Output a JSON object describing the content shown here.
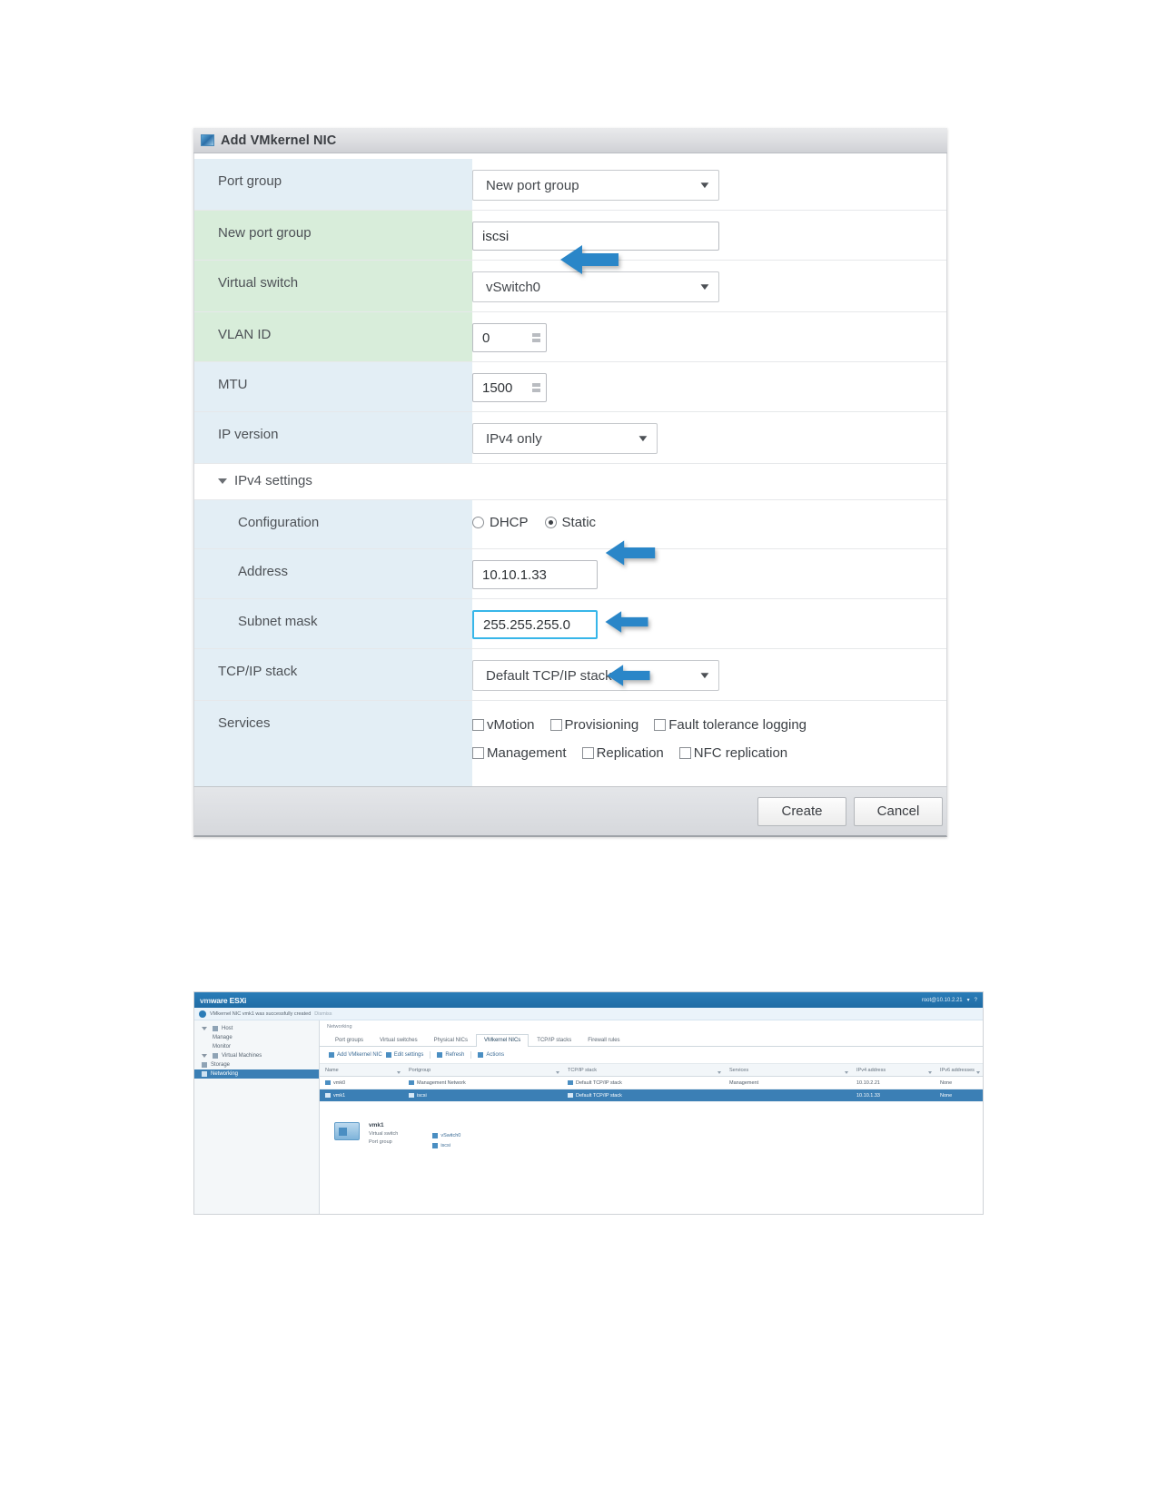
{
  "dialog": {
    "title": "Add VMkernel NIC",
    "title_icon": "vmkernel-nic-icon",
    "rows": [
      {
        "label": "Port group",
        "value": "New port group",
        "widget": "select"
      },
      {
        "label": "New port group",
        "value": "iscsi",
        "widget": "text"
      },
      {
        "label": "Virtual switch",
        "value": "vSwitch0",
        "widget": "select"
      },
      {
        "label": "VLAN ID",
        "value": "0",
        "widget": "spinner"
      },
      {
        "label": "MTU",
        "value": "1500",
        "widget": "spinner"
      },
      {
        "label": "IP version",
        "value": "IPv4 only",
        "widget": "select"
      }
    ],
    "ipv4_section_label": "IPv4 settings",
    "configuration": {
      "label": "Configuration",
      "options": [
        "DHCP",
        "Static"
      ],
      "selected": "Static"
    },
    "address": {
      "label": "Address",
      "value": "10.10.1.33"
    },
    "subnet": {
      "label": "Subnet mask",
      "value": "255.255.255.0"
    },
    "tcpip": {
      "label": "TCP/IP stack",
      "value": "Default TCP/IP stack"
    },
    "services": {
      "label": "Services",
      "items": [
        {
          "label": "vMotion",
          "checked": false
        },
        {
          "label": "Provisioning",
          "checked": false
        },
        {
          "label": "Fault tolerance logging",
          "checked": false
        },
        {
          "label": "Management",
          "checked": false
        },
        {
          "label": "Replication",
          "checked": false
        },
        {
          "label": "NFC replication",
          "checked": false
        }
      ]
    },
    "footer": {
      "create_label": "Create",
      "cancel_label": "Cancel"
    },
    "annotations": {
      "arrow_color": "#2a86c8",
      "arrows": [
        "new-port-group",
        "configuration-static",
        "address",
        "subnet-mask"
      ]
    }
  },
  "esxi": {
    "brand_vm": "vm",
    "brand_ware": "ware",
    "brand_product": "ESXi",
    "user": "root@10.10.2.21",
    "notification": "VMkernel NIC vmk1 was successfully created",
    "notification_link": "Dismiss",
    "navigator": [
      {
        "label": "Host",
        "icon": "host-icon",
        "level": 0
      },
      {
        "label": "Manage",
        "icon": "manage-icon",
        "level": 1
      },
      {
        "label": "Monitor",
        "icon": "monitor-icon",
        "level": 1
      },
      {
        "label": "Virtual Machines",
        "icon": "vm-icon",
        "level": 0
      },
      {
        "label": "Storage",
        "icon": "storage-icon",
        "level": 0
      },
      {
        "label": "Networking",
        "icon": "network-icon",
        "level": 0,
        "active": true
      }
    ],
    "breadcrumb": [
      "Networking"
    ],
    "tabs": [
      {
        "label": "Port groups",
        "selected": false
      },
      {
        "label": "Virtual switches",
        "selected": false
      },
      {
        "label": "Physical NICs",
        "selected": false
      },
      {
        "label": "VMkernel NICs",
        "selected": true
      },
      {
        "label": "TCP/IP stacks",
        "selected": false
      },
      {
        "label": "Firewall rules",
        "selected": false
      }
    ],
    "toolbar": [
      {
        "label": "Add VMkernel NIC",
        "icon": "add-nic-icon"
      },
      {
        "label": "Edit settings",
        "icon": "pencil-icon"
      },
      {
        "label": "Refresh",
        "icon": "refresh-icon"
      },
      {
        "label": "Actions",
        "icon": "actions-icon"
      }
    ],
    "table": {
      "columns": [
        "Name",
        "Portgroup",
        "TCP/IP stack",
        "Services",
        "IPv4 address",
        "IPv6 addresses"
      ],
      "rows": [
        {
          "name": "vmk0",
          "portgroup": "Management Network",
          "stack": "Default TCP/IP stack",
          "services": "Management",
          "ipv4": "10.10.2.21",
          "ipv6": "None",
          "selected": false
        },
        {
          "name": "vmk1",
          "portgroup": "iscsi",
          "stack": "Default TCP/IP stack",
          "services": "",
          "ipv4": "10.10.1.33",
          "ipv6": "None",
          "selected": true
        }
      ]
    },
    "detail": {
      "title": "vmk1",
      "rows": [
        "Virtual switch",
        "Port group"
      ],
      "links": [
        {
          "label": "vSwitch0",
          "icon": "vswitch-icon"
        },
        {
          "label": "iscsi",
          "icon": "portgroup-icon"
        }
      ]
    }
  }
}
